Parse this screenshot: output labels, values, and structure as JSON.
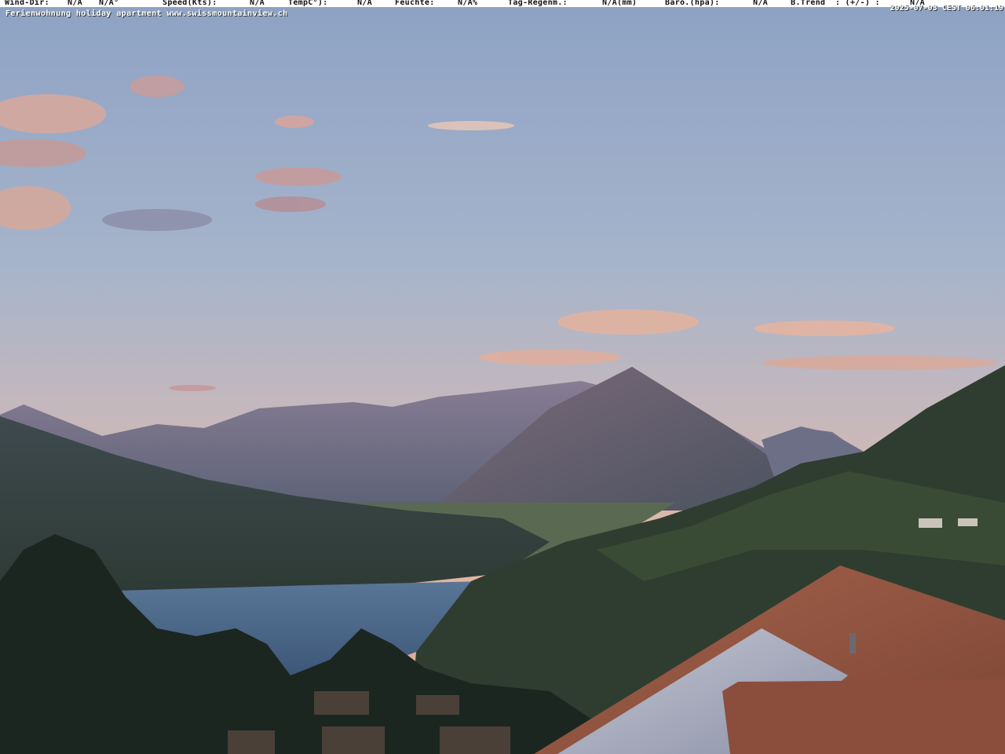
{
  "overlay": {
    "wind_dir_label": "Wind-Dir:",
    "wind_dir_value": "N/A",
    "wind_deg_value": "N/A°",
    "speed_label": "Speed(Kts):",
    "speed_value": "N/A",
    "temp_label": "TempC°):",
    "temp_value": "N/A",
    "humidity_label": "Feuchte:",
    "humidity_value": "N/A%",
    "rain_label": "Tag-Regenm.:",
    "rain_value": "N/A(mm)",
    "baro_label": "Baro.(hpa):",
    "baro_value": "N/A",
    "trend_label": "B.Trend  : (+/-) :",
    "trend_value": "N/A",
    "caption": "Ferienwohnung holiday apartment www.swissmountainview.ch",
    "timestamp": "2025-07-03 CEST 06:01:19"
  },
  "scene": {
    "sky_top": "#8fa4c6",
    "sky_bottom": "#e0b5a2",
    "lake": "#3f5b7c",
    "roof": "#9a5a44"
  }
}
